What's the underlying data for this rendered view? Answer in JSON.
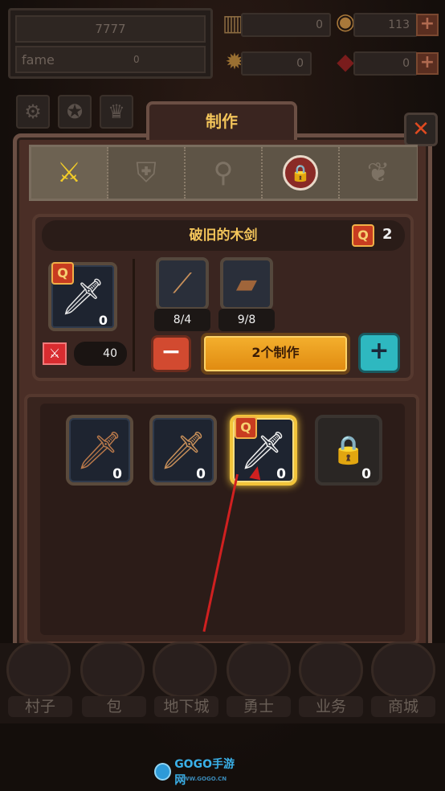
{
  "stats": {
    "main_value": "7777",
    "fame_label": "fame",
    "fame_value": "0"
  },
  "resources": {
    "gold_bars": "0",
    "coins": "113",
    "gear": "0",
    "gems": "0",
    "plus_label": "+"
  },
  "top_icons": {
    "settings": "⚙",
    "badge": "✪",
    "crown": "♛"
  },
  "window": {
    "title": "制作",
    "close_label": "✕"
  },
  "categories": [
    {
      "name": "sword",
      "glyph": "⚔"
    },
    {
      "name": "shield",
      "glyph": "⛨"
    },
    {
      "name": "net",
      "glyph": "⚲"
    },
    {
      "name": "lock",
      "glyph": "🔒"
    },
    {
      "name": "pet",
      "glyph": "❦"
    }
  ],
  "craft": {
    "item_name": "破旧的木剑",
    "quality_label": "Q",
    "quality_level": "2",
    "main_count": "0",
    "materials": [
      {
        "name": "stick",
        "glyph": "⟋",
        "count": "8/4"
      },
      {
        "name": "wood",
        "glyph": "▰",
        "count": "9/8"
      }
    ],
    "power_value": "40",
    "minus_label": "−",
    "craft_button": "2个制作",
    "plus_label": "+"
  },
  "items": [
    {
      "count": "0",
      "glyph": "🗡"
    },
    {
      "count": "0",
      "glyph": "🗡"
    },
    {
      "count": "0",
      "glyph": "🗡"
    },
    {
      "count": "0",
      "glyph": "🔒"
    }
  ],
  "nav": {
    "tabs": [
      "村子",
      "包",
      "地下城",
      "勇士",
      "业务",
      "商城"
    ]
  },
  "watermark": {
    "text": "GOGO手游网",
    "sub": "WWW.GOGO.CN"
  },
  "colors": {
    "accent_gold": "#f2c45a",
    "craft_button": "#f4b02e",
    "plus_button": "#2eb8c0",
    "minus_button": "#d24a30",
    "arrow_annotation": "#d02020"
  }
}
